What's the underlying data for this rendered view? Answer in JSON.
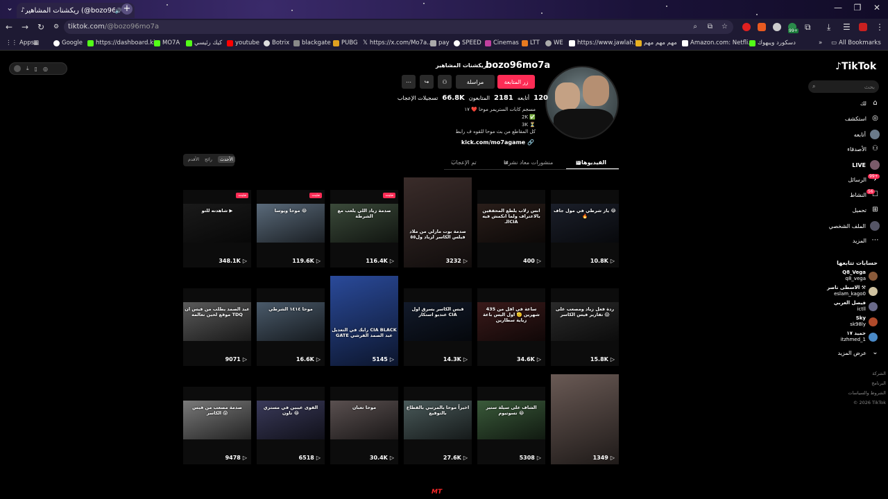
{
  "browser": {
    "tab_title": "ريكشنات المشاهير (@bozo96mo7a",
    "url_host": "tiktok.com",
    "url_path": "/@bozo96mo7a",
    "bookmarks": [
      "Apps",
      "Google",
      "https://dashboard.ki...",
      "MO7A",
      "كيك رئيسي",
      "youtube",
      "Botrix",
      "blackgate",
      "PUBG",
      "https://x.com/Mo7a...",
      "pay",
      "SPEED",
      "Cinemas",
      "LTT",
      "WE",
      "https://www.jawlah.l...",
      "مهم مهم مهم",
      "Amazon.com: Netfli...",
      "دسكورد ويبهوك",
      "All Bookmarks"
    ],
    "ext_badge": "99+"
  },
  "sidebar": {
    "logo": "TikTok",
    "search_placeholder": "بحث",
    "items": [
      "لك",
      "استكشف",
      "أتابعه",
      "الأصدقاء",
      "LIVE",
      "الرسائل",
      "النشاط",
      "تحميل",
      "الملف الشخصي",
      "المزيد"
    ],
    "messages_badge": "99+",
    "activity_badge": "56",
    "following_header": "حسابات تتابعها",
    "following": [
      {
        "name": "Q8_Vega",
        "handle": "q8_vega",
        "color": "#8a5a3a"
      },
      {
        "name": "الاسطى ناصر ⚒",
        "handle": "eslam_kago0",
        "color": "#cfc2a0"
      },
      {
        "name": "فيصل العربي",
        "handle": "ictll",
        "color": "#6a6a8a"
      },
      {
        "name": "Sky",
        "handle": "sk98ly",
        "color": "#b04a2a"
      },
      {
        "name": "حميد ١٧",
        "handle": "itzhmed_1",
        "color": "#4a8ac8"
      }
    ],
    "see_more": "عرض المزيد",
    "footer": [
      "الشركة",
      "البرنامج",
      "الشروط والسياسات",
      "© 2026 TikTok"
    ]
  },
  "profile": {
    "username": "bozo96mo7a",
    "display_name": "ريكشنات المشاهير",
    "buttons": {
      "edit": "زر المتابعة",
      "message": "مراسلة"
    },
    "stats": {
      "following_count": "120",
      "following_label": "أتابعه",
      "followers_count": "2181",
      "followers_label": "المتابعون",
      "likes_count": "66.8K",
      "likes_label": "تسجيلات الإعجاب"
    },
    "bio": [
      "مسجم كابات الستريمر موحا ❤️ ١٧",
      "2K ✅",
      "3K ⏳",
      "كل المقاطع من بث موحا للقوه ف رابط"
    ],
    "link": "kick.com/mo7agame",
    "tabs": {
      "videos": "الفيديوهات",
      "reposts": "منشورات معاد نشرها",
      "liked": "تم الإعجاب"
    },
    "sort": {
      "latest": "الأحدث",
      "popular": "رائج",
      "oldest": "الأقدم"
    }
  },
  "videos": [
    {
      "views": "10.8K",
      "caption": "ياز شرطي في مول جاف 😂🔥",
      "pinned": false
    },
    {
      "views": "400",
      "caption": "انس زلاب يلطع المحققين بالاعتراف ولما انكمش فيه الـCIA",
      "pinned": false
    },
    {
      "views": "3232",
      "caption": "صدمة بوت مارلي من ملاد فيلس الكاسر لزياد ول٥٥",
      "pinned": false
    },
    {
      "views": "116.4K",
      "caption": "صدمة زياد اللي يلعب مع الشرطة",
      "pinned": true
    },
    {
      "views": "119.6K",
      "caption": "موحا ويوسا 😂",
      "pinned": true
    },
    {
      "views": "348.1K",
      "caption": "شاهدته للتو ▶",
      "pinned": true
    },
    {
      "views": "15.8K",
      "caption": "ردة فعل زياد ومصعب على تقارير فيس الكاسر 😱",
      "pinned": false
    },
    {
      "views": "34.6K",
      "caption": "435 ساعة في اقل من شهرين 🫡 اول اليس باعة زياية سطارين",
      "pinned": false
    },
    {
      "views": "14.3K",
      "caption": "قبس الكاسر يسرق اول عندبو استكار CIA",
      "pinned": false
    },
    {
      "views": "5145",
      "caption": "رايك في التعديل CIA BLACK GATE عبد الصمد القرشي",
      "pinned": false
    },
    {
      "views": "16.6K",
      "caption": "موحا ١٤١٤ الشرطي",
      "pinned": false
    },
    {
      "views": "9071",
      "caption": "عبد الصمد يطلب من فيس ان موقع لحين نعالمه TDQ",
      "pinned": false
    },
    {
      "views": "1349",
      "caption": "",
      "pinned": false
    },
    {
      "views": "5308",
      "caption": "الشاف على سيلة ستير تسوتيوم 😂",
      "pinned": false
    },
    {
      "views": "27.6K",
      "caption": "اخيراً موحا بالمرتبي بالقطاع بالتوقيع",
      "pinned": false
    },
    {
      "views": "30.4K",
      "caption": "موحا تعبان",
      "pinned": false
    },
    {
      "views": "6518",
      "caption": "القوى عيبين في مستري تاون 😂",
      "pinned": false
    },
    {
      "views": "9478",
      "caption": "صدمة مصعب من فيس الكاسر 😱",
      "pinned": false
    }
  ],
  "watermark": "MT"
}
